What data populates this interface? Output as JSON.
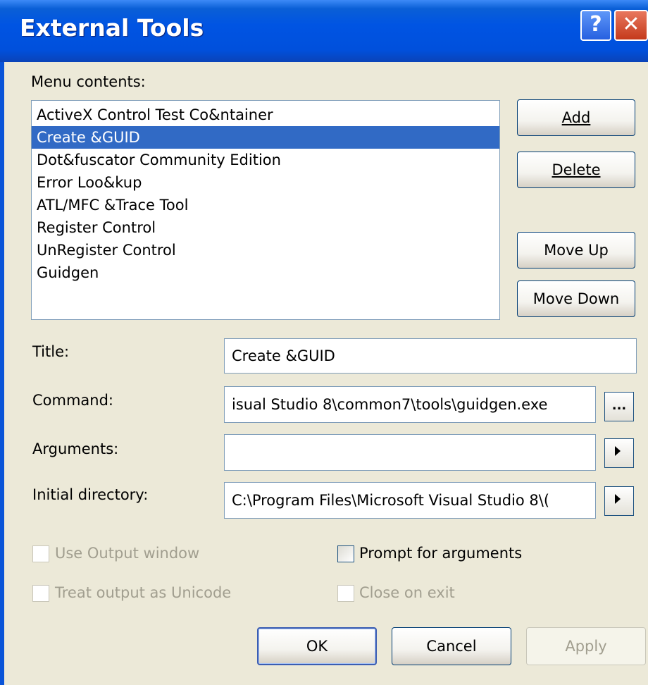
{
  "window": {
    "title": "External Tools",
    "help": "?",
    "close": "✕"
  },
  "menu_contents_label": "Menu contents:",
  "menu_items": [
    "ActiveX Control Test Co&ntainer",
    "Create &GUID",
    "Dot&fuscator Community Edition",
    "Error Loo&kup",
    "ATL/MFC &Trace Tool",
    "Register Control",
    "UnRegister Control",
    "Guidgen"
  ],
  "selected_index": 1,
  "buttons": {
    "add": "Add",
    "delete": "Delete",
    "move_up": "Move Up",
    "move_down": "Move Down",
    "ok": "OK",
    "cancel": "Cancel",
    "apply": "Apply",
    "browse": "..."
  },
  "fields": {
    "title": {
      "label": "Title:",
      "value": "Create &GUID"
    },
    "command": {
      "label": "Command:",
      "value": "isual Studio 8\\common7\\tools\\guidgen.exe"
    },
    "arguments": {
      "label": "Arguments:",
      "value": ""
    },
    "initial_directory": {
      "label": "Initial directory:",
      "value": "C:\\Program Files\\Microsoft Visual Studio 8\\("
    }
  },
  "options": {
    "use_output_window": {
      "label": "Use Output window",
      "checked": false,
      "enabled": false
    },
    "prompt_for_arguments": {
      "label": "Prompt for arguments",
      "checked": false,
      "enabled": true
    },
    "treat_output_unicode": {
      "label": "Treat output as Unicode",
      "checked": false,
      "enabled": false
    },
    "close_on_exit": {
      "label": "Close on exit",
      "checked": false,
      "enabled": false
    }
  }
}
